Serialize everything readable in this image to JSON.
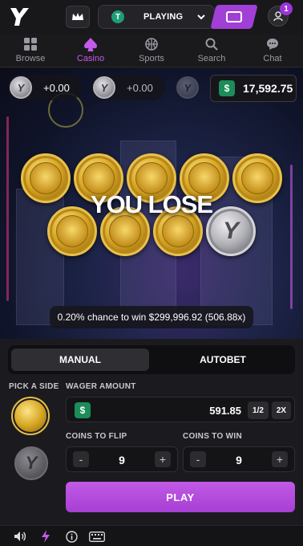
{
  "header": {
    "status_coin": "T",
    "status_label": "PLAYING",
    "notification_count": "1",
    "brand_accent": "#a13fd6"
  },
  "nav": {
    "items": [
      {
        "label": "Browse",
        "icon": "grid-icon"
      },
      {
        "label": "Casino",
        "icon": "spade-icon",
        "active": true
      },
      {
        "label": "Sports",
        "icon": "basketball-icon"
      },
      {
        "label": "Search",
        "icon": "search-icon"
      },
      {
        "label": "Chat",
        "icon": "chat-icon"
      }
    ]
  },
  "game": {
    "side_balance_1": "+0.00",
    "side_balance_2": "+0.00",
    "balance": "17,592.75",
    "currency_symbol": "$",
    "result_text": "YOU LOSE",
    "chance_text": "0.20% chance to win $299,996.92 (506.88x)",
    "coins": [
      "gold",
      "gold",
      "gold",
      "gold",
      "gold",
      "gold",
      "gold",
      "gold",
      "silver"
    ]
  },
  "controls": {
    "tabs": [
      {
        "label": "MANUAL",
        "active": true
      },
      {
        "label": "AUTOBET",
        "active": false
      }
    ],
    "pick_side_label": "PICK A SIDE",
    "wager_label": "WAGER AMOUNT",
    "wager_value": "591.85",
    "half_label": "1/2",
    "double_label": "2X",
    "coins_to_flip_label": "COINS TO FLIP",
    "coins_to_flip_value": "9",
    "coins_to_win_label": "COINS TO WIN",
    "coins_to_win_value": "9",
    "minus": "-",
    "plus": "+",
    "play_label": "PLAY"
  },
  "footer": {
    "icons": [
      "sound-icon",
      "lightning-icon",
      "info-icon",
      "keyboard-icon"
    ]
  }
}
